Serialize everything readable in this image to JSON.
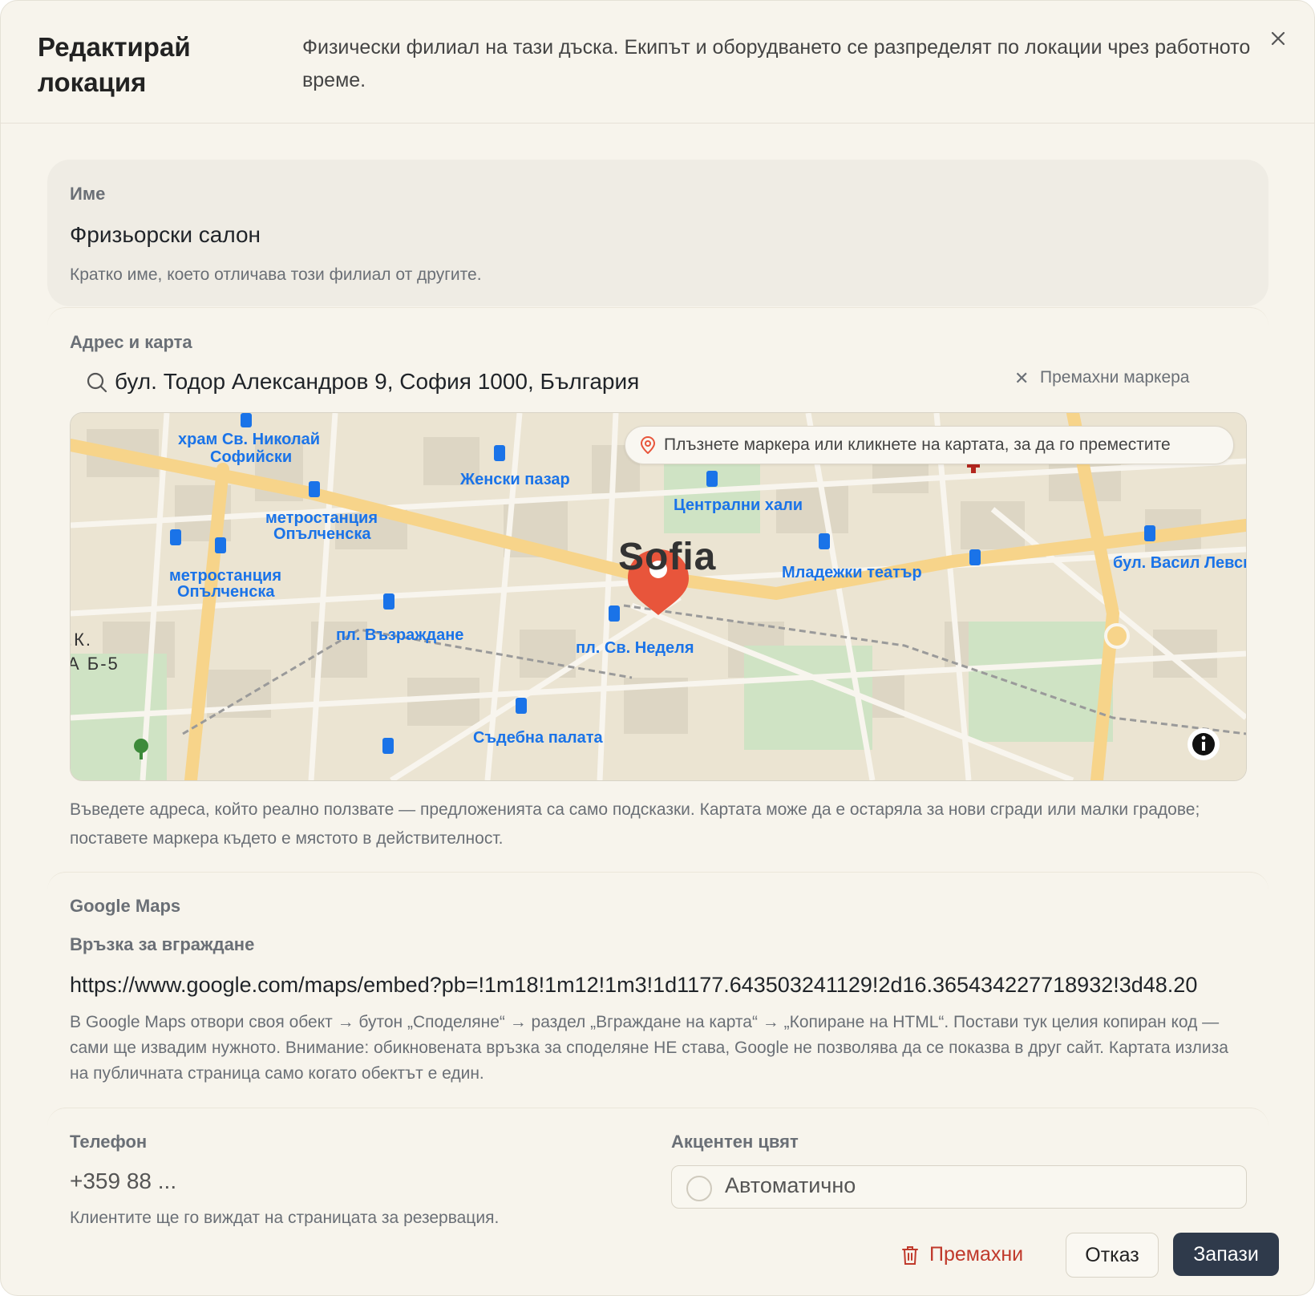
{
  "dialog": {
    "title": "Редактирай локация",
    "description": "Физически филиал на тази дъска. Екипът и оборудването се разпределят по локации чрез работното време."
  },
  "name_field": {
    "label": "Име",
    "value": "Фризьорски салон",
    "hint": "Кратко име, което отличава този филиал от другите."
  },
  "address": {
    "label": "Адрес и карта",
    "value": "бул. Тодор Александров 9, София 1000, България",
    "remove_marker": "Премахни маркера",
    "map_tip": "Плъзнете маркера или кликнете на картата, за да го преместите",
    "hint": "Въведете адреса, който реално ползвате — предложенията са само подсказки. Картата може да е остаряла за нови сгради или малки градове; поставете маркера където е мястото в действителност."
  },
  "map": {
    "city_label": "Sofia",
    "labels": [
      "храм Св. Николай",
      "Софийски",
      "Женски пазар",
      "Централни хали",
      "метростанция",
      "Опълченска",
      "метростанция",
      "Опълченска",
      "Младежки театър",
      "бул. Васил Левски",
      "пл. Възраждане",
      "пл. Св. Неделя",
      "Съдебна палата",
      ".К.",
      "А Б-5"
    ]
  },
  "google_maps": {
    "section": "Google Maps",
    "label": "Връзка за вграждане",
    "value": "https://www.google.com/maps/embed?pb=!1m18!1m12!1m3!1d1177.643503241129!2d16.365434227718932!3d48.20",
    "hint": "В Google Maps отвори своя обект → бутон „Споделяне“ → раздел „Вграждане на карта“ → „Копиране на HTML“. Постави тук целия копиран код — сами ще извадим нужното. Внимание: обикновената връзка за споделяне НЕ става, Google не позволява да се показва в друг сайт. Картата излиза на публичната страница само когато обектът е един."
  },
  "phone": {
    "label": "Телефон",
    "placeholder": "+359 88 ...",
    "hint": "Клиентите ще го виждат на страницата за резервация."
  },
  "accent_color": {
    "label": "Акцентен цвят",
    "value": "Автоматично"
  },
  "footer": {
    "remove": "Премахни",
    "cancel": "Отказ",
    "save": "Запази"
  },
  "colors": {
    "background": "#f7f4ec",
    "primary_button": "#2f3a4b",
    "danger": "#c0392b",
    "map_marker": "#e8553b",
    "transit_label": "#1a73e8"
  }
}
